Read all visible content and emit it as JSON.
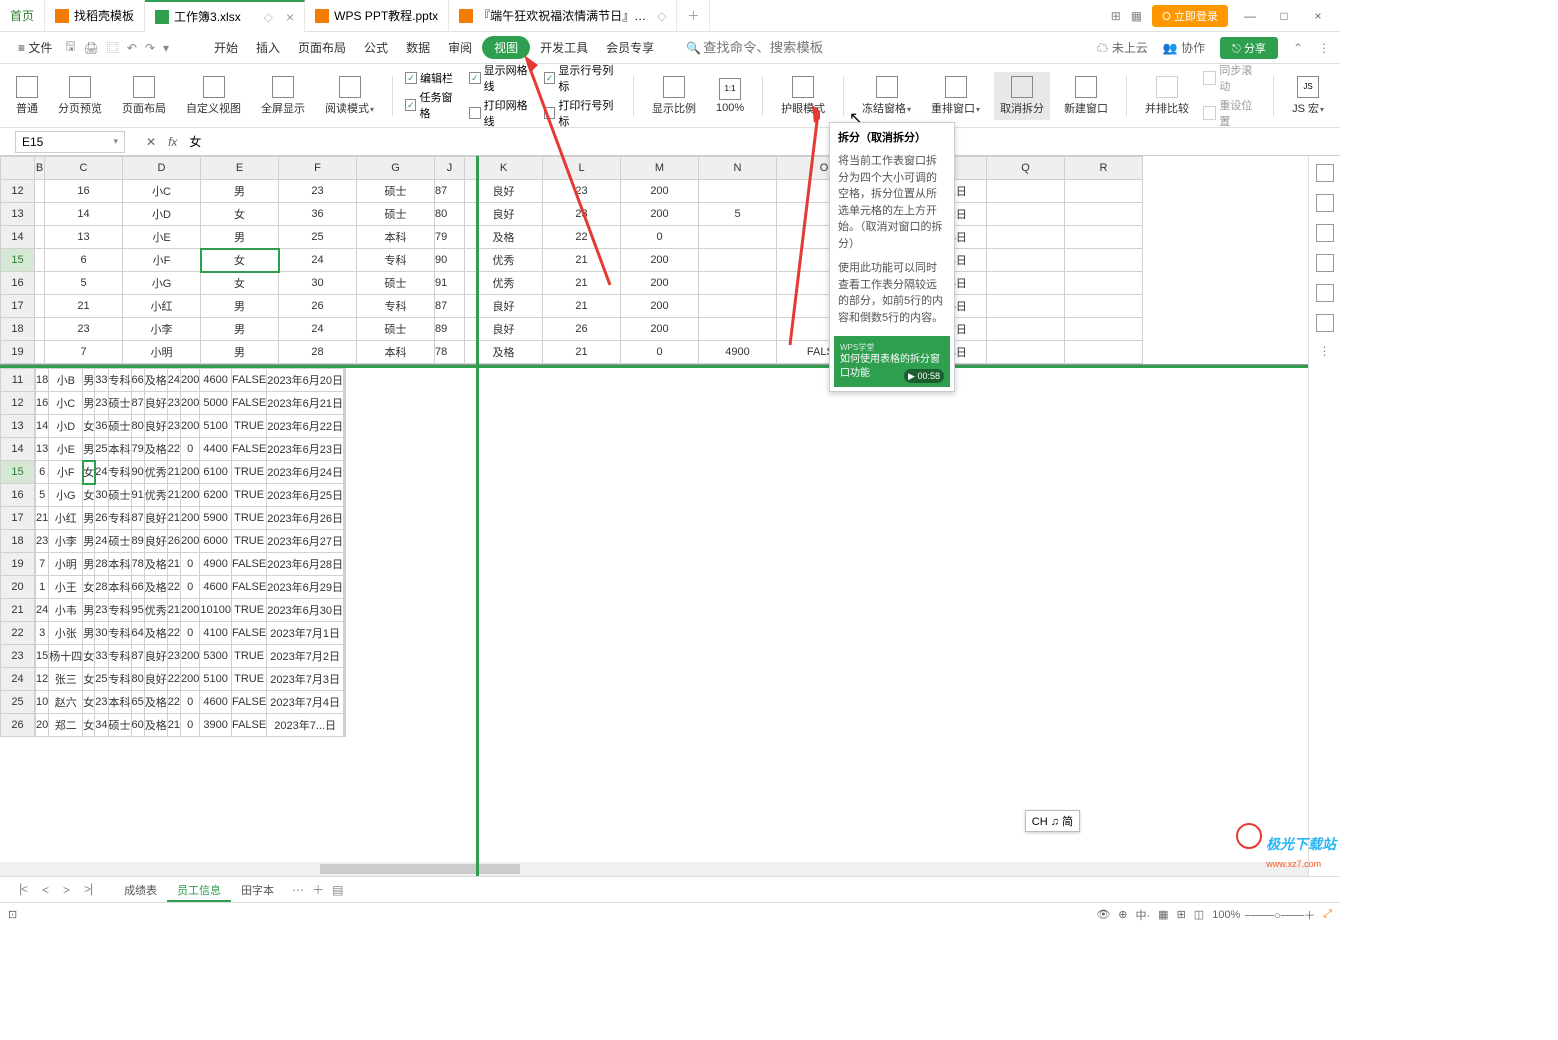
{
  "titlebar": {
    "home": "首页",
    "tabs": [
      {
        "label": "找稻壳模板",
        "icon": "orange"
      },
      {
        "label": "工作簿3.xlsx",
        "icon": "green",
        "active": true
      },
      {
        "label": "WPS PPT教程.pptx",
        "icon": "ppt"
      },
      {
        "label": "『端午狂欢祝福浓情满节日』…",
        "icon": "ppt"
      }
    ],
    "login": "立即登录"
  },
  "menubar": {
    "file": "文件",
    "items": [
      "开始",
      "插入",
      "页面布局",
      "公式",
      "数据",
      "审阅",
      "视图",
      "开发工具",
      "会员专享"
    ],
    "active": "视图",
    "search_placeholder": "查找命令、搜索模板",
    "cloud": "未上云",
    "collab": "协作",
    "share": "分享"
  },
  "ribbon": {
    "normal": "普通",
    "pagebreak": "分页预览",
    "pagelayout": "页面布局",
    "custom": "自定义视图",
    "fullscreen": "全屏显示",
    "reading": "阅读模式",
    "check_editbar": "编辑栏",
    "check_taskpane": "任务窗格",
    "check_gridlines": "显示网格线",
    "check_printgrid": "打印网格线",
    "check_rowcol": "显示行号列标",
    "check_printrowcol": "打印行号列标",
    "zoomratio": "显示比例",
    "zoom100": "100%",
    "eyecare": "护眼模式",
    "freeze": "冻结窗格",
    "arrange": "重排窗口",
    "split_cancel": "取消拆分",
    "newwindow": "新建窗口",
    "sidebyside": "并排比较",
    "syncscroll": "同步滚动",
    "resetpos": "重设位置",
    "jsmacro": "JS 宏"
  },
  "tooltip": {
    "title": "拆分（取消拆分）",
    "body1": "将当前工作表窗口拆分为四个大小可调的空格，拆分位置从所选单元格的左上方开始。（取消对窗口的拆分）",
    "body2": "使用此功能可以同时查看工作表分隔较远的部分，如前5行的内容和倒数5行的内容。",
    "video": "如何使用表格的拆分窗口功能",
    "time": "00:58"
  },
  "formulabar": {
    "name": "E15",
    "value": "女"
  },
  "columns": [
    "",
    "B",
    "C",
    "D",
    "E",
    "F",
    "G",
    "J",
    "K",
    "L",
    "M",
    "N",
    "O",
    "P",
    "Q",
    "R"
  ],
  "pane1_rows": [
    {
      "n": "12",
      "b": "16",
      "c": "小C",
      "d": "男",
      "e": "23",
      "f": "硕士",
      "j": "87",
      "k": "良好",
      "l": "23",
      "m": "200",
      "n2": "",
      "o": "",
      "p": "2023年6月21日"
    },
    {
      "n": "13",
      "b": "14",
      "c": "小D",
      "d": "女",
      "e": "36",
      "f": "硕士",
      "j": "80",
      "k": "良好",
      "l": "23",
      "m": "200",
      "n2": "5",
      "o": "",
      "p": "2023年6月22日"
    },
    {
      "n": "14",
      "b": "13",
      "c": "小E",
      "d": "男",
      "e": "25",
      "f": "本科",
      "j": "79",
      "k": "及格",
      "l": "22",
      "m": "0",
      "n2": "",
      "o": "",
      "p": "2023年6月23日"
    },
    {
      "n": "15",
      "b": "6",
      "c": "小F",
      "d": "女",
      "e": "24",
      "f": "专科",
      "j": "90",
      "k": "优秀",
      "l": "21",
      "m": "200",
      "n2": "",
      "o": "",
      "p": "2023年6月24日",
      "sel": true
    },
    {
      "n": "16",
      "b": "5",
      "c": "小G",
      "d": "女",
      "e": "30",
      "f": "硕士",
      "j": "91",
      "k": "优秀",
      "l": "21",
      "m": "200",
      "n2": "",
      "o": "",
      "p": "2023年6月25日"
    },
    {
      "n": "17",
      "b": "21",
      "c": "小红",
      "d": "男",
      "e": "26",
      "f": "专科",
      "j": "87",
      "k": "良好",
      "l": "21",
      "m": "200",
      "n2": "",
      "o": "",
      "p": "2023年6月26日"
    },
    {
      "n": "18",
      "b": "23",
      "c": "小李",
      "d": "男",
      "e": "24",
      "f": "硕士",
      "j": "89",
      "k": "良好",
      "l": "26",
      "m": "200",
      "n2": "",
      "o": "",
      "p": "2023年6月27日"
    },
    {
      "n": "19",
      "b": "7",
      "c": "小明",
      "d": "男",
      "e": "28",
      "f": "本科",
      "j": "78",
      "k": "及格",
      "l": "21",
      "m": "0",
      "n2": "4900",
      "o": "FALSE",
      "p": "2023年6月28日"
    }
  ],
  "pane2_rows": [
    {
      "n": "11",
      "b": "18",
      "c": "小B",
      "d": "男",
      "e": "33",
      "f": "专科",
      "j": "66",
      "k": "及格",
      "l": "24",
      "m": "200",
      "n2": "4600",
      "o": "FALSE",
      "p": "2023年6月20日"
    },
    {
      "n": "12",
      "b": "16",
      "c": "小C",
      "d": "男",
      "e": "23",
      "f": "硕士",
      "j": "87",
      "k": "良好",
      "l": "23",
      "m": "200",
      "n2": "5000",
      "o": "FALSE",
      "p": "2023年6月21日"
    },
    {
      "n": "13",
      "b": "14",
      "c": "小D",
      "d": "女",
      "e": "36",
      "f": "硕士",
      "j": "80",
      "k": "良好",
      "l": "23",
      "m": "200",
      "n2": "5100",
      "o": "TRUE",
      "p": "2023年6月22日"
    },
    {
      "n": "14",
      "b": "13",
      "c": "小E",
      "d": "男",
      "e": "25",
      "f": "本科",
      "j": "79",
      "k": "及格",
      "l": "22",
      "m": "0",
      "n2": "4400",
      "o": "FALSE",
      "p": "2023年6月23日"
    },
    {
      "n": "15",
      "b": "6",
      "c": "小F",
      "d": "女",
      "e": "24",
      "f": "专科",
      "j": "90",
      "k": "优秀",
      "l": "21",
      "m": "200",
      "n2": "6100",
      "o": "TRUE",
      "p": "2023年6月24日",
      "sel": true
    },
    {
      "n": "16",
      "b": "5",
      "c": "小G",
      "d": "女",
      "e": "30",
      "f": "硕士",
      "j": "91",
      "k": "优秀",
      "l": "21",
      "m": "200",
      "n2": "6200",
      "o": "TRUE",
      "p": "2023年6月25日"
    },
    {
      "n": "17",
      "b": "21",
      "c": "小红",
      "d": "男",
      "e": "26",
      "f": "专科",
      "j": "87",
      "k": "良好",
      "l": "21",
      "m": "200",
      "n2": "5900",
      "o": "TRUE",
      "p": "2023年6月26日"
    },
    {
      "n": "18",
      "b": "23",
      "c": "小李",
      "d": "男",
      "e": "24",
      "f": "硕士",
      "j": "89",
      "k": "良好",
      "l": "26",
      "m": "200",
      "n2": "6000",
      "o": "TRUE",
      "p": "2023年6月27日"
    },
    {
      "n": "19",
      "b": "7",
      "c": "小明",
      "d": "男",
      "e": "28",
      "f": "本科",
      "j": "78",
      "k": "及格",
      "l": "21",
      "m": "0",
      "n2": "4900",
      "o": "FALSE",
      "p": "2023年6月28日"
    },
    {
      "n": "20",
      "b": "1",
      "c": "小王",
      "d": "女",
      "e": "28",
      "f": "本科",
      "j": "66",
      "k": "及格",
      "l": "22",
      "m": "0",
      "n2": "4600",
      "o": "FALSE",
      "p": "2023年6月29日"
    },
    {
      "n": "21",
      "b": "24",
      "c": "小韦",
      "d": "男",
      "e": "23",
      "f": "专科",
      "j": "95",
      "k": "优秀",
      "l": "21",
      "m": "200",
      "n2": "10100",
      "o": "TRUE",
      "p": "2023年6月30日"
    },
    {
      "n": "22",
      "b": "3",
      "c": "小张",
      "d": "男",
      "e": "30",
      "f": "专科",
      "j": "64",
      "k": "及格",
      "l": "22",
      "m": "0",
      "n2": "4100",
      "o": "FALSE",
      "p": "2023年7月1日"
    },
    {
      "n": "23",
      "b": "15",
      "c": "杨十四",
      "d": "女",
      "e": "33",
      "f": "专科",
      "j": "87",
      "k": "良好",
      "l": "23",
      "m": "200",
      "n2": "5300",
      "o": "TRUE",
      "p": "2023年7月2日"
    },
    {
      "n": "24",
      "b": "12",
      "c": "张三",
      "d": "女",
      "e": "25",
      "f": "专科",
      "j": "80",
      "k": "良好",
      "l": "22",
      "m": "200",
      "n2": "5100",
      "o": "TRUE",
      "p": "2023年7月3日"
    },
    {
      "n": "25",
      "b": "10",
      "c": "赵六",
      "d": "女",
      "e": "23",
      "f": "本科",
      "j": "65",
      "k": "及格",
      "l": "22",
      "m": "0",
      "n2": "4600",
      "o": "FALSE",
      "p": "2023年7月4日"
    },
    {
      "n": "26",
      "b": "20",
      "c": "郑二",
      "d": "女",
      "e": "34",
      "f": "硕士",
      "j": "60",
      "k": "及格",
      "l": "21",
      "m": "0",
      "n2": "3900",
      "o": "FALSE",
      "p": "2023年7...日"
    }
  ],
  "sheettabs": {
    "list": [
      "成绩表",
      "员工信息",
      "田字本"
    ],
    "active": "员工信息"
  },
  "statusbar": {
    "zoom": "100%"
  },
  "ime": "CH ♫ 简",
  "watermark": {
    "brand": "极光下载站",
    "url": "www.xz7.com"
  }
}
